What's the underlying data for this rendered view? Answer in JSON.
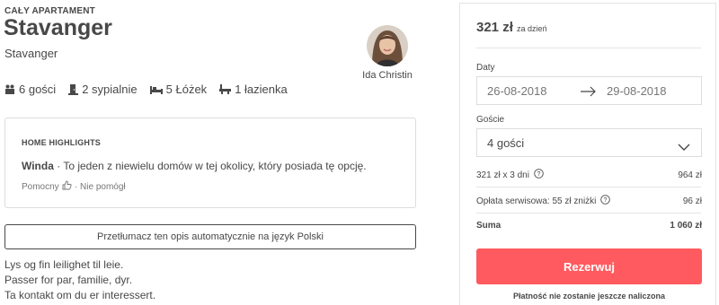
{
  "listing": {
    "type_label": "CAŁY APARTAMENT",
    "title": "Stavanger",
    "location": "Stavanger",
    "host_name": "Ida Christin"
  },
  "amenities": [
    {
      "icon": "guests-icon",
      "label": "6 gości"
    },
    {
      "icon": "bedroom-icon",
      "label": "2 sypialnie"
    },
    {
      "icon": "bed-icon",
      "label": "5 Łóżek"
    },
    {
      "icon": "bath-icon",
      "label": "1 łazienka"
    }
  ],
  "highlights": {
    "heading": "HOME HIGHLIGHTS",
    "feature": "Winda",
    "text": " · To jeden z niewielu domów w tej okolicy, który posiada tę opcję.",
    "helpful": "Pomocny",
    "separator": "·",
    "not_helpful": "Nie pomógł"
  },
  "translate_button": "Przetłumacz ten opis automatycznie na język Polski",
  "description": [
    "Lys og fin leilighet til leie.",
    "Passer for par, familie, dyr.",
    "Ta kontakt om du er interessert."
  ],
  "booking": {
    "price": "321 zł",
    "price_per": "za dzień",
    "dates_label": "Daty",
    "check_in": "26-08-2018",
    "check_out": "29-08-2018",
    "guests_label": "Goście",
    "guests_value": "4 gości",
    "nights_label": "321 zł x 3 dni",
    "nights_total": "964 zł",
    "service_label": "Opłata serwisowa: 55 zł zniżki",
    "service_total": "96 zł",
    "sum_label": "Suma",
    "sum_total": "1 060 zł",
    "reserve_button": "Rezerwuj",
    "note": "Płatność nie zostanie jeszcze naliczona"
  },
  "colors": {
    "accent": "#ff5a5f",
    "text": "#484848",
    "muted": "#767676",
    "border": "#dddddd"
  }
}
